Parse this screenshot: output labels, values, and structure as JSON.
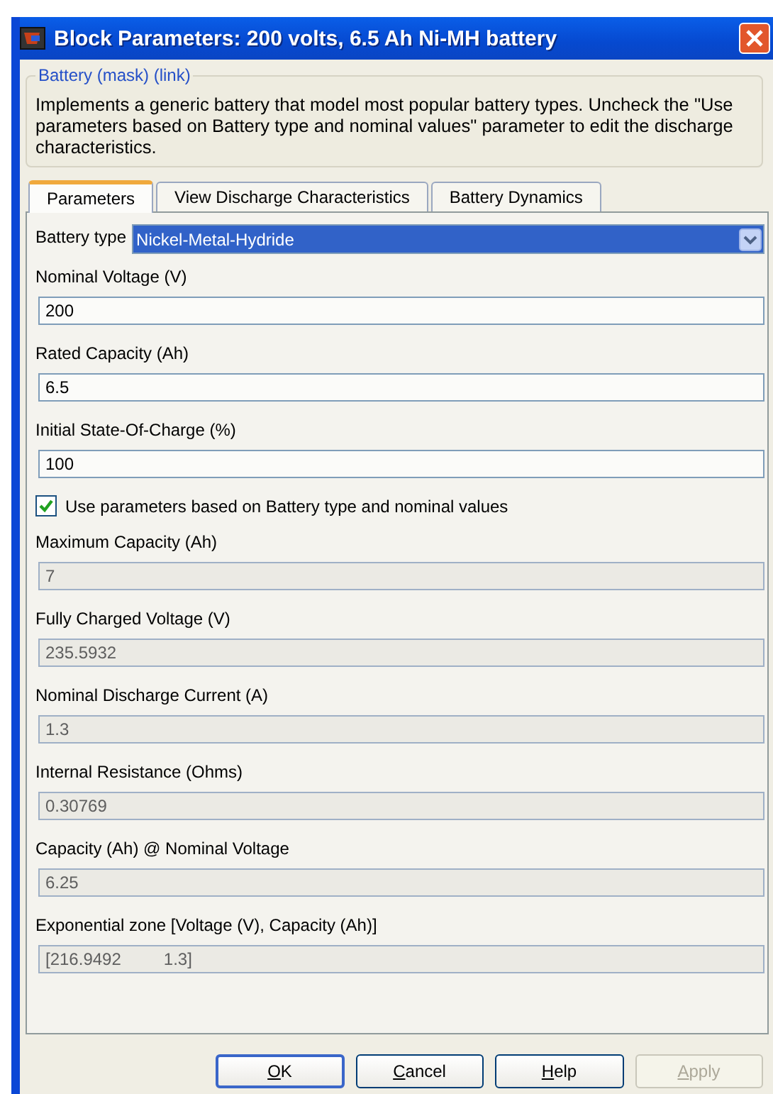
{
  "window": {
    "title": "Block Parameters: 200 volts, 6.5 Ah Ni-MH battery"
  },
  "mask": {
    "title": "Battery (mask) (link)",
    "description": "Implements a generic battery that model most popular battery types. Uncheck the \"Use parameters based on Battery type and nominal values\" parameter to edit the discharge characteristics."
  },
  "tabs": [
    {
      "label": "Parameters",
      "selected": true
    },
    {
      "label": "View Discharge Characteristics",
      "selected": false
    },
    {
      "label": "Battery Dynamics",
      "selected": false
    }
  ],
  "battery_type": {
    "label": "Battery type",
    "value": "Nickel-Metal-Hydride"
  },
  "parameters": [
    {
      "kind": "field",
      "label": "Nominal Voltage (V)",
      "value": "200",
      "disabled": false
    },
    {
      "kind": "field",
      "label": "Rated Capacity (Ah)",
      "value": "6.5",
      "disabled": false
    },
    {
      "kind": "field",
      "label": "Initial State-Of-Charge (%)",
      "value": "100",
      "disabled": false
    },
    {
      "kind": "checkbox",
      "label": "Use parameters based on Battery type and nominal values",
      "checked": true
    },
    {
      "kind": "field",
      "label": "Maximum Capacity (Ah)",
      "value": "7",
      "disabled": true
    },
    {
      "kind": "field",
      "label": "Fully Charged Voltage (V)",
      "value": "235.5932",
      "disabled": true
    },
    {
      "kind": "field",
      "label": "Nominal Discharge Current (A)",
      "value": "1.3",
      "disabled": true
    },
    {
      "kind": "field",
      "label": "Internal Resistance (Ohms)",
      "value": "0.30769",
      "disabled": true
    },
    {
      "kind": "field",
      "label": "Capacity (Ah) @ Nominal Voltage",
      "value": "6.25",
      "disabled": true
    },
    {
      "kind": "field",
      "label": "Exponential zone [Voltage (V), Capacity (Ah)]",
      "value": "[216.9492         1.3]",
      "disabled": true
    }
  ],
  "buttons": [
    {
      "label": "OK",
      "default": true,
      "disabled": false
    },
    {
      "label": "Cancel",
      "default": false,
      "disabled": false
    },
    {
      "label": "Help",
      "default": false,
      "disabled": false
    },
    {
      "label": "Apply",
      "default": false,
      "disabled": true
    }
  ]
}
